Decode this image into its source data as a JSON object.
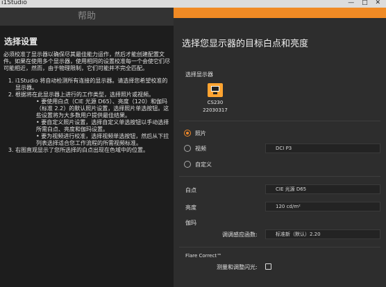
{
  "window": {
    "title": "i1Studio",
    "controls": "— □ ✕"
  },
  "help": {
    "header": "帮助",
    "heading": "选择设置",
    "intro": "必须校准了显示器以确保尽其最佳能力运作，然后才能创建配置文件。如果在使用多个显示器，使用相同的设置校准每一个会使它们尽可能相近，然而，由于物理限制，它们可能并不完全匹配。",
    "step1": "i1Studio 将自动检测所有连接的显示器。请选择您希望校准的显示器。",
    "step2": "根据将在此显示器上进行的工作类型，选择照片或视频。",
    "bullets": [
      "要使用白点（CIE 光源 D65）、亮度（120）和伽玛（标准 2.2）的默认照片设置，选择照片单选按钮。这些设置将为大多数用户提供最佳结果。",
      "要自定义照片设置，选择自定义单选按钮以手动选择所需白点、亮度和伽玛设置。",
      "要为视频进行校准，选择视频单选按钮，然后从下拉列表选择适合您工作流程的所需视频标准。"
    ],
    "step3": "右图直观显示了您所选择的白点出现在色域中的位置。"
  },
  "main": {
    "title": "选择您显示器的目标白点和亮度",
    "select_display_label": "选择显示器",
    "monitor_name": "CS230",
    "monitor_serial": "22030317",
    "options": {
      "photo": "照片",
      "video": "视频",
      "custom": "自定义"
    },
    "video_standard": "DCI P3",
    "white_point_label": "白点",
    "white_point_value": "CIE 光源 D65",
    "brightness_label": "亮度",
    "brightness_value": "120 cd/m²",
    "gamma_label": "伽玛",
    "tone_curve_label": "调调感应函数:",
    "tone_curve_value": "标准新（默认）2.20",
    "flare_label": "Flare Correct™",
    "flare_measure_label": "测量和调整闪光:"
  },
  "colors": {
    "accent": "#f08a24",
    "monitor_icon": "#ffa431"
  }
}
